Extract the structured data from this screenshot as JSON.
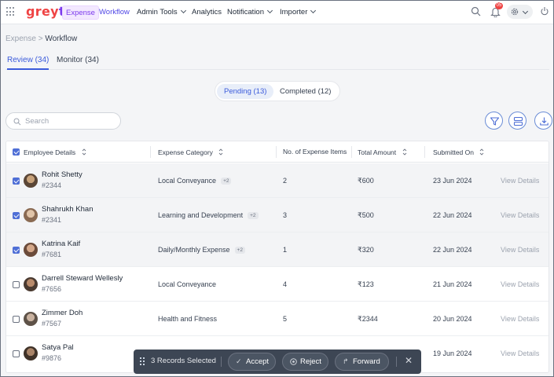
{
  "brand": {
    "logo_left": "grey",
    "logo_right": "t"
  },
  "nav": {
    "items": [
      {
        "label": "Expense"
      },
      {
        "label": "Workflow"
      },
      {
        "label": "Admin Tools"
      },
      {
        "label": "Analytics"
      },
      {
        "label": "Notification"
      },
      {
        "label": "Importer"
      }
    ],
    "notification_count": "05"
  },
  "breadcrumb": {
    "parent": "Expense",
    "separator": ">",
    "current": "Workflow"
  },
  "tabs": [
    {
      "label": "Review (34)"
    },
    {
      "label": "Monitor (34)"
    }
  ],
  "status_toggle": {
    "pending": "Pending (13)",
    "completed": "Completed (12)"
  },
  "search": {
    "placeholder": "Search",
    "value": ""
  },
  "table": {
    "headers": {
      "employee": "Employee Details",
      "category": "Expense Category",
      "count": "No. of Expense Items",
      "amount": "Total Amount",
      "submitted": "Submitted  On"
    },
    "rows": [
      {
        "name": "Rohit Shetty",
        "id": "#2344",
        "category": "Local Conveyance",
        "extra": "+2",
        "count": "2",
        "amount": "₹600",
        "date": "23 Jun 2024",
        "action": "View Details",
        "checked": true
      },
      {
        "name": "Shahrukh Khan",
        "id": "#2341",
        "category": "Learning and Development",
        "extra": "+2",
        "count": "3",
        "amount": "₹500",
        "date": "22 Jun 2024",
        "action": "View Details",
        "checked": true
      },
      {
        "name": "Katrina Kaif",
        "id": "#7681",
        "category": "Daily/Monthly Expense",
        "extra": "+2",
        "count": "1",
        "amount": "₹320",
        "date": "22 Jun 2024",
        "action": "View Details",
        "checked": true
      },
      {
        "name": "Darrell Steward Wellesly",
        "id": "#7656",
        "category": "Local Conveyance",
        "extra": "",
        "count": "4",
        "amount": "₹123",
        "date": "21 Jun 2024",
        "action": "View Details",
        "checked": false
      },
      {
        "name": "Zimmer Doh",
        "id": "#7567",
        "category": "Health and Fitness",
        "extra": "",
        "count": "5",
        "amount": "₹2344",
        "date": "20 Jun 2024",
        "action": "View Details",
        "checked": false
      },
      {
        "name": "Satya Pal",
        "id": "#9876",
        "category": "",
        "extra": "",
        "count": "",
        "amount": "",
        "date": "19 Jun 2024",
        "action": "View Details",
        "checked": false
      }
    ]
  },
  "bulk_bar": {
    "selected_text": "3 Records Selected",
    "accept": "Accept",
    "reject": "Reject",
    "forward": "Forward"
  },
  "colors": {
    "accent": "#3b5bdb",
    "brand_red": "#ef4444",
    "brand_purple": "#7c3aed",
    "bulk_bar": "#3d4654"
  }
}
